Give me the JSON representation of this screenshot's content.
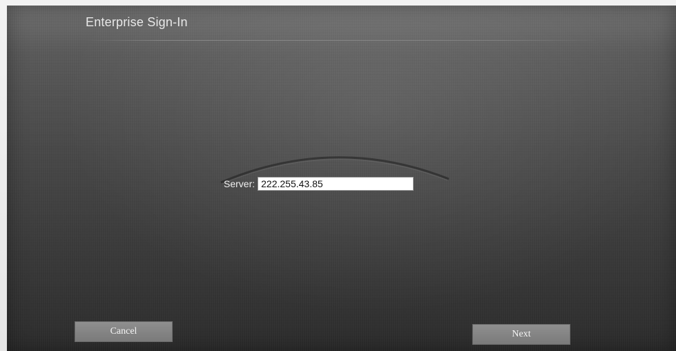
{
  "dialog": {
    "title": "Enterprise Sign-In"
  },
  "server": {
    "label": "Server:",
    "value": "222.255.43.85"
  },
  "buttons": {
    "cancel_label": "Cancel",
    "next_label": "Next"
  },
  "colors": {
    "background_top": "#6f6f6f",
    "background_bottom": "#2c2c2c",
    "button": "#858585",
    "text": "#f0f0f0"
  }
}
